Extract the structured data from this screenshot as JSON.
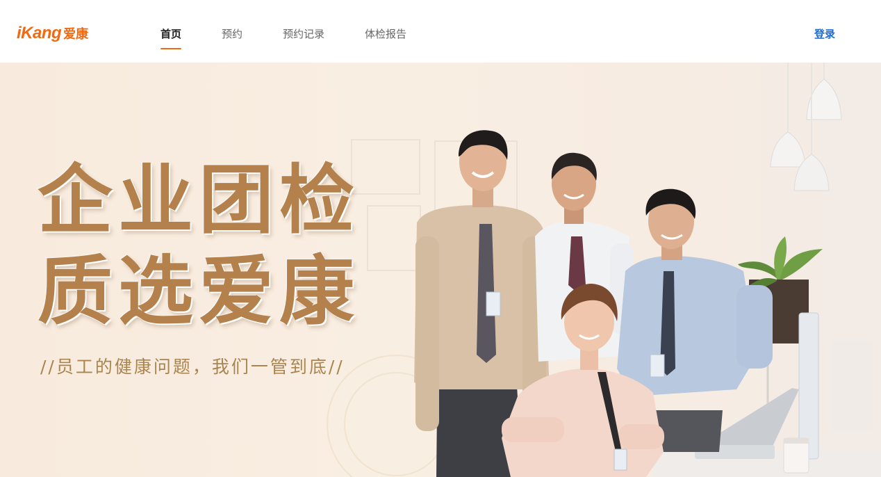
{
  "header": {
    "logo_mark": "iKang",
    "logo_cn": "爱康",
    "nav": [
      {
        "label": "首页",
        "active": true
      },
      {
        "label": "预约",
        "active": false
      },
      {
        "label": "预约记录",
        "active": false
      },
      {
        "label": "体检报告",
        "active": false
      }
    ],
    "login_label": "登录"
  },
  "banner": {
    "headline_line1": "企业团检",
    "headline_line2": "质选爱康",
    "tagline": "//员工的健康问题，我们一管到底//"
  },
  "colors": {
    "brand_orange": "#ef6a13",
    "link_blue": "#1f6bd6",
    "headline_gold": "#b4814c",
    "banner_bg": "#f8ebde"
  },
  "icons": [
    "ikang-logo",
    "pendant-lamp-icon",
    "plant-icon",
    "laptop-icon",
    "cup-icon"
  ]
}
